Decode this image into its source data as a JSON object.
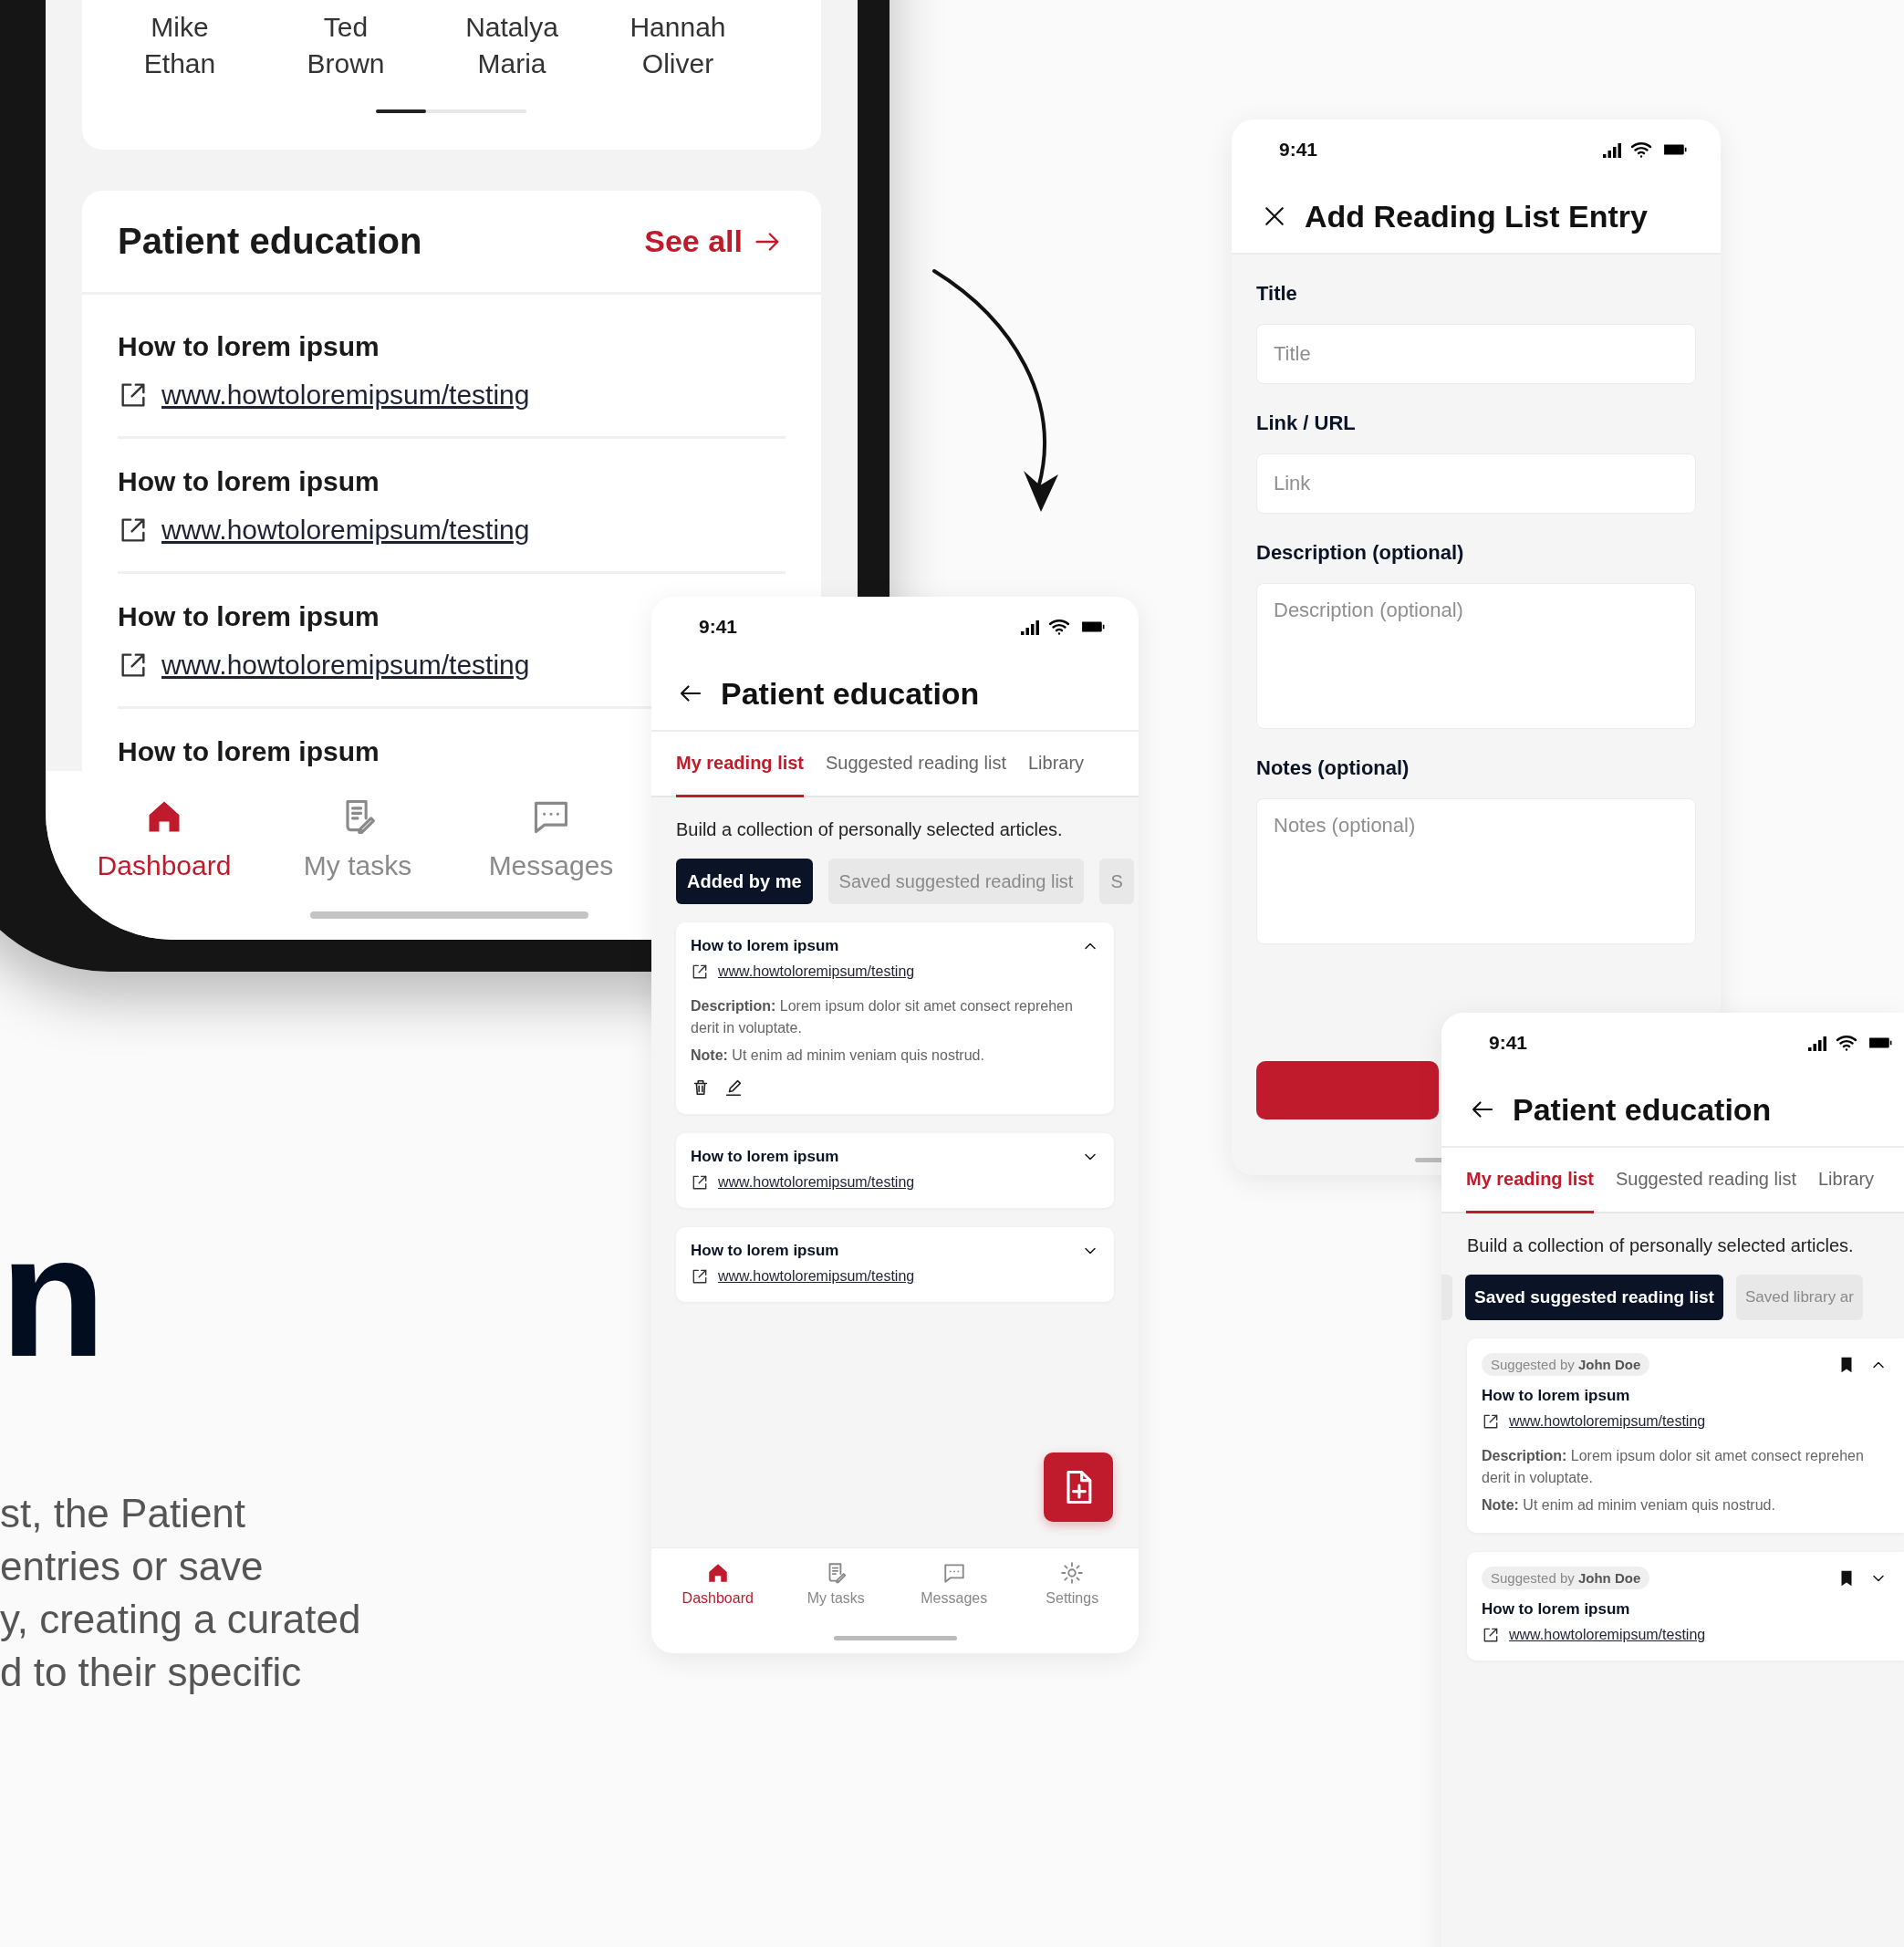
{
  "showcase_phone": {
    "contacts": [
      {
        "first_name": "Mike",
        "last_name": "Ethan"
      },
      {
        "first_name": "Ted",
        "last_name": "Brown"
      },
      {
        "first_name": "Natalya",
        "last_name": "Maria"
      },
      {
        "first_name": "Hannah",
        "last_name": "Oliver"
      }
    ],
    "section_title": "Patient education",
    "see_all": "See all",
    "articles": [
      {
        "title": "How to lorem ipsum",
        "url": "www.howtoloremipsum/testing"
      },
      {
        "title": "How to lorem ipsum",
        "url": "www.howtoloremipsum/testing"
      },
      {
        "title": "How to lorem ipsum",
        "url": "www.howtoloremipsum/testing"
      },
      {
        "title": "How to lorem ipsum"
      }
    ],
    "nav": [
      {
        "label": "Dashboard",
        "selected": true
      },
      {
        "label": "My tasks",
        "selected": false
      },
      {
        "label": "Messages",
        "selected": false
      }
    ]
  },
  "reading_list_screen": {
    "time": "9:41",
    "title": "Patient education",
    "tabs": [
      {
        "label": "My reading list",
        "selected": true
      },
      {
        "label": "Suggested reading list",
        "selected": false
      },
      {
        "label": "Library",
        "selected": false
      }
    ],
    "intro": "Build a collection of personally selected articles.",
    "filters": [
      {
        "label": "Added by me",
        "selected": true
      },
      {
        "label": "Saved suggested reading list",
        "selected": false
      },
      {
        "label": "S",
        "selected": false
      }
    ],
    "entries": [
      {
        "title": "How to lorem ipsum",
        "url": "www.howtoloremipsum/testing",
        "expanded": true,
        "description": "**Description:** Lorem ipsum dolor sit amet consect reprehen derit in voluptate.",
        "note": "**Note:** Ut enim ad minim veniam quis nostrud."
      },
      {
        "title": "How to lorem ipsum",
        "url": "www.howtoloremipsum/testing",
        "expanded": false
      },
      {
        "title": "How to lorem ipsum",
        "url": "www.howtoloremipsum/testing",
        "expanded": false
      }
    ],
    "nav": [
      {
        "label": "Dashboard",
        "selected": true
      },
      {
        "label": "My tasks",
        "selected": false
      },
      {
        "label": "Messages",
        "selected": false
      },
      {
        "label": "Settings",
        "selected": false
      }
    ]
  },
  "add_entry_screen": {
    "time": "9:41",
    "title": "Add Reading List Entry",
    "fields": [
      {
        "label": "Title",
        "placeholder": "Title",
        "kind": "input"
      },
      {
        "label": "Link / URL",
        "placeholder": "Link",
        "kind": "input"
      },
      {
        "label": "Description (optional)",
        "placeholder": "Description (optional)",
        "kind": "textarea"
      },
      {
        "label": "Notes (optional)",
        "placeholder": "Notes (optional)",
        "kind": "textarea"
      }
    ]
  },
  "saved_screen": {
    "time": "9:41",
    "title": "Patient education",
    "tabs": [
      {
        "label": "My reading list",
        "selected": true
      },
      {
        "label": "Suggested reading list",
        "selected": false
      },
      {
        "label": "Library",
        "selected": false
      }
    ],
    "intro": "Build a collection of personally selected articles.",
    "filters": [
      {
        "label": "Saved suggested reading list",
        "selected": true
      },
      {
        "label": "Saved library ar",
        "selected": false
      }
    ],
    "entries": [
      {
        "suggested_by": "Suggested by **John Doe**",
        "bookmarked": true,
        "expanded": true,
        "title": "How to lorem ipsum",
        "url": "www.howtoloremipsum/testing",
        "description": "**Description:** Lorem ipsum dolor sit amet consect reprehen derit in voluptate.",
        "note": "**Note:** Ut enim ad minim veniam quis nostrud."
      },
      {
        "suggested_by": "Suggested by **John Doe**",
        "bookmarked": true,
        "expanded": false,
        "title": "How to lorem ipsum",
        "url": "www.howtoloremipsum/testing"
      }
    ]
  },
  "hero": {
    "headline": "n",
    "paragraph": [
      "st, the Patient",
      "entries or save",
      "y, creating a curated",
      "d to their specific"
    ]
  }
}
